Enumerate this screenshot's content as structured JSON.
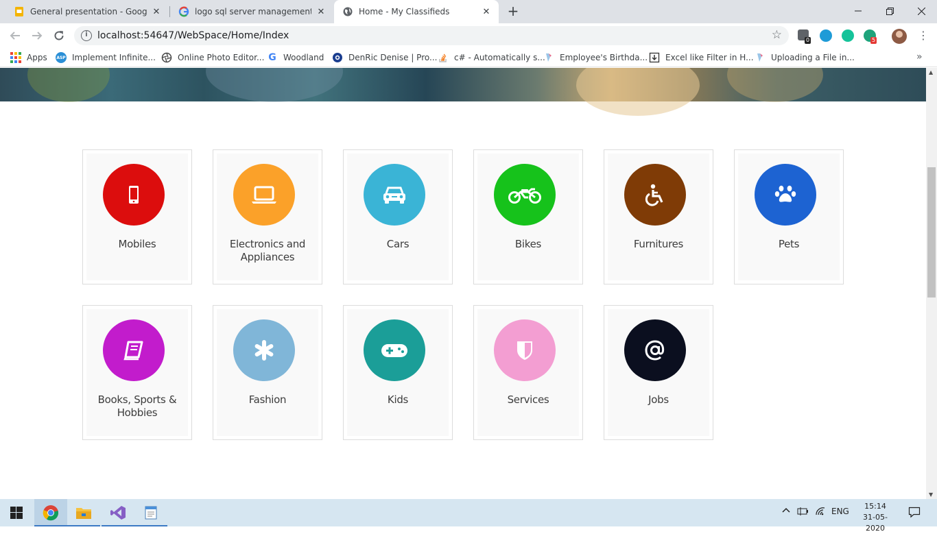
{
  "browser": {
    "tabs": [
      {
        "title": "General presentation - Google Sl",
        "icon": "google-slides-icon",
        "active": false
      },
      {
        "title": "logo sql server management stuc",
        "icon": "google-search-icon",
        "active": false
      },
      {
        "title": "Home - My Classifieds",
        "icon": "globe-icon",
        "active": true
      }
    ],
    "new_tab": "+",
    "url": "localhost:54647/WebSpace/Home/Index",
    "extensions": [
      {
        "name": "clipboard-extension-icon",
        "color": "#5f6368",
        "badge": "0"
      },
      {
        "name": "messenger-extension-icon",
        "color": "#1e9bd7",
        "badge": ""
      },
      {
        "name": "grammarly-extension-icon",
        "color": "#15c39a",
        "badge": ""
      },
      {
        "name": "abp-extension-icon",
        "color": "#1ea37b",
        "badge": "5"
      }
    ]
  },
  "bookmarks": [
    {
      "label": "Apps",
      "icon": "apps-grid-icon"
    },
    {
      "label": "Implement Infinite...",
      "icon": "asp-icon",
      "color": "#2b8fd6"
    },
    {
      "label": "Online Photo Editor...",
      "icon": "aperture-icon",
      "color": "#444444"
    },
    {
      "label": "Woodland",
      "icon": "google-icon",
      "color": "#4285f4"
    },
    {
      "label": "DenRic Denise | Pro...",
      "icon": "eye-icon",
      "color": "#1a3d8f"
    },
    {
      "label": "c# - Automatically s...",
      "icon": "stackoverflow-icon",
      "color": "#f48024"
    },
    {
      "label": "Employee's Birthda...",
      "icon": "aspsnippets-icon",
      "color": "#6ea8d9"
    },
    {
      "label": "Excel like Filter in H...",
      "icon": "download-icon",
      "color": "#333333"
    },
    {
      "label": "Uploading a File in...",
      "icon": "aspsnippets-icon",
      "color": "#6ea8d9"
    }
  ],
  "categories": [
    {
      "label": "Mobiles",
      "icon": "mobile-phone-icon",
      "color": "#dc0d0d"
    },
    {
      "label": "Electronics and Appliances",
      "icon": "laptop-icon",
      "color": "#fba129"
    },
    {
      "label": "Cars",
      "icon": "car-icon",
      "color": "#3ab4d6"
    },
    {
      "label": "Bikes",
      "icon": "motorcycle-icon",
      "color": "#16c21b"
    },
    {
      "label": "Furnitures",
      "icon": "wheelchair-icon",
      "color": "#7f3b06"
    },
    {
      "label": "Pets",
      "icon": "paw-icon",
      "color": "#1d63d2"
    },
    {
      "label": "Books, Sports & Hobbies",
      "icon": "book-icon",
      "color": "#c21ccc"
    },
    {
      "label": "Fashion",
      "icon": "asterisk-icon",
      "color": "#80b6d8"
    },
    {
      "label": "Kids",
      "icon": "gamepad-icon",
      "color": "#1b9e98"
    },
    {
      "label": "Services",
      "icon": "shield-icon",
      "color": "#f39ed2"
    },
    {
      "label": "Jobs",
      "icon": "at-sign-icon",
      "color": "#0b0f1f"
    }
  ],
  "taskbar": {
    "apps": [
      "windows-start-icon",
      "chrome-icon",
      "file-explorer-icon",
      "visual-studio-icon",
      "notepad-icon"
    ],
    "language": "ENG",
    "time": "15:14",
    "date": "31-05-2020"
  }
}
